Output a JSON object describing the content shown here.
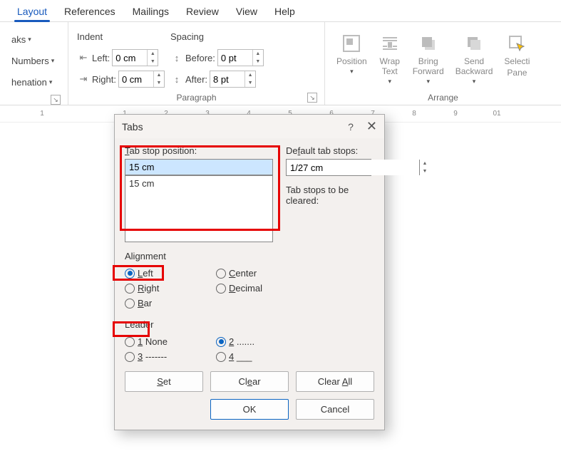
{
  "tabs": {
    "layout": "Layout",
    "references": "References",
    "mailings": "Mailings",
    "review": "Review",
    "view": "View",
    "help": "Help"
  },
  "ribbon": {
    "breaks": "aks",
    "line_numbers": "Numbers",
    "hyphenation": "henation",
    "indent_label": "Indent",
    "left_label": "Left:",
    "right_label": "Right:",
    "left_val": "0 cm",
    "right_val": "0 cm",
    "spacing_label": "Spacing",
    "before_label": "Before:",
    "after_label": "After:",
    "before_val": "0 pt",
    "after_val": "8 pt",
    "paragraph_group": "Paragraph",
    "position": "Position",
    "wrap_text": "Wrap\nText",
    "bring_forward": "Bring\nForward",
    "send_backward": "Send\nBackward",
    "selection_pane_a": "Selecti",
    "selection_pane_b": "Pane",
    "arrange_group": "Arrange"
  },
  "ruler": [
    "1",
    "",
    "1",
    "2",
    "3",
    "4",
    "5",
    "6",
    "7",
    "8",
    "9",
    "01"
  ],
  "dialog": {
    "title": "Tabs",
    "tab_stop_label": "Tab stop position:",
    "tab_stop_value": "15 cm",
    "list_item": "15 cm",
    "default_label": "Default tab stops:",
    "default_value": "1/27 cm",
    "cleared_label": "Tab stops to be cleared:",
    "alignment_label": "Alignment",
    "align": {
      "left": "Left",
      "center": "Center",
      "right": "Right",
      "decimal": "Decimal",
      "bar": "Bar"
    },
    "leader_label": "Leader",
    "leader": {
      "n1": "1 None",
      "n2": "2 .......",
      "n3": "3 -------",
      "n4": "4 ___"
    },
    "btn_set": "Set",
    "btn_clear": "Clear",
    "btn_clear_all": "Clear All",
    "btn_ok": "OK",
    "btn_cancel": "Cancel"
  }
}
